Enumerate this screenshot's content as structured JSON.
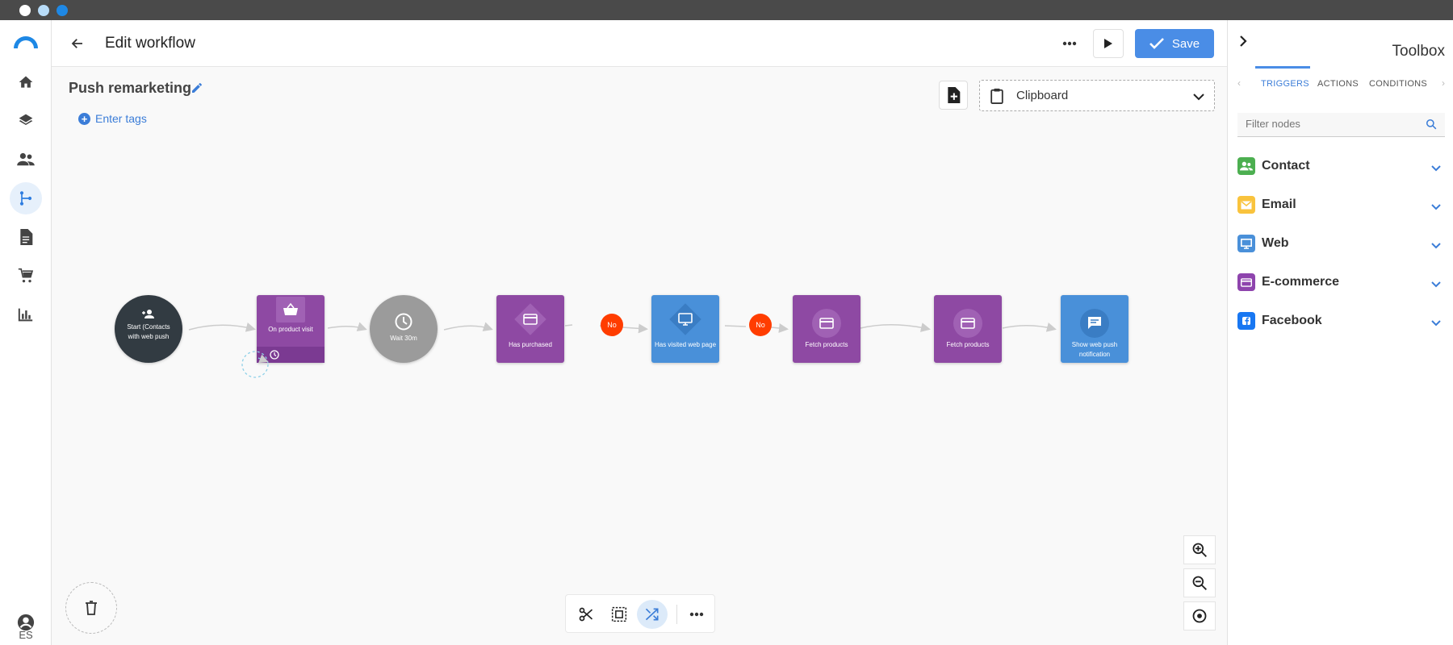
{
  "header": {
    "title": "Edit workflow",
    "save_label": "Save"
  },
  "workflow": {
    "name": "Push remarketing",
    "tags_label": "Enter tags"
  },
  "clipboard": {
    "label": "Clipboard"
  },
  "nodes": {
    "start": "Start (Contacts with web push",
    "product_visit": "On product visit",
    "wait": "Wait 30m",
    "has_purchased": "Has purchased",
    "visited_page": "Has visited web page",
    "fetch1": "Fetch products",
    "fetch2": "Fetch products",
    "push": "Show web push notification",
    "no1": "No",
    "no2": "No"
  },
  "language": "ES",
  "toolbox": {
    "title": "Toolbox",
    "tabs": [
      "TRIGGERS",
      "ACTIONS",
      "CONDITIONS"
    ],
    "filter_placeholder": "Filter nodes",
    "categories": [
      {
        "label": "Contact",
        "color": "#4caf50"
      },
      {
        "label": "Email",
        "color": "#f9c33d"
      },
      {
        "label": "Web",
        "color": "#4a90d9"
      },
      {
        "label": "E-commerce",
        "color": "#8e44ad"
      },
      {
        "label": "Facebook",
        "color": "#1877f2"
      }
    ]
  },
  "colors": {
    "accent": "#4a8de6",
    "purple_node": "#8e4aa3",
    "blue_node": "#4a90d9",
    "no_badge": "#ff3d00"
  }
}
